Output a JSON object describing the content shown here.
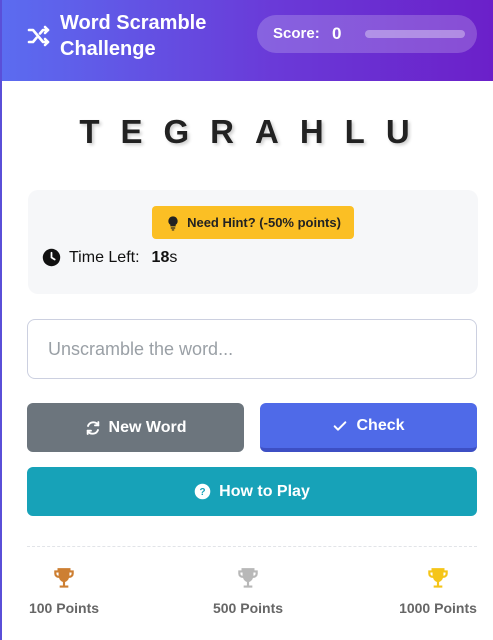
{
  "header": {
    "title": "Word Scramble Challenge",
    "score_label": "Score:",
    "score_value": "0",
    "score_progress": 0
  },
  "game": {
    "scrambled": "TEGRAHLU",
    "hint_label": "Need Hint? (-50% points)",
    "time_label": "Time Left:",
    "time_value": "18",
    "time_unit": "s"
  },
  "input": {
    "placeholder": "Unscramble the word..."
  },
  "buttons": {
    "new_word": "New Word",
    "check": "Check",
    "how_to_play": "How to Play"
  },
  "rewards": [
    {
      "label": "100 Points",
      "color": "#cd7f32"
    },
    {
      "label": "500 Points",
      "color": "#b8b8b8"
    },
    {
      "label": "1000 Points",
      "color": "#f5c518"
    }
  ],
  "colors": {
    "header_gradient": [
      "#5b6cf0",
      "#6b20c9"
    ],
    "hint": "#fbbf24",
    "new_word": "#6c757d",
    "check": "#4f6ae8",
    "how_to_play": "#17a2b8"
  },
  "icons": {
    "title": "shuffle-icon",
    "hint": "lightbulb-icon",
    "timer": "clock-icon",
    "new_word": "refresh-icon",
    "check": "checkmark-icon",
    "how_to_play": "question-circle-icon",
    "reward": "trophy-icon"
  }
}
